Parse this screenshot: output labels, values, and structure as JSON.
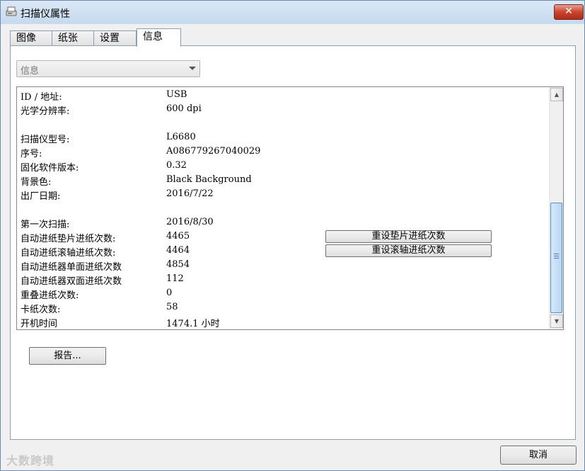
{
  "window": {
    "title": "扫描仪属性",
    "close_glyph": "✕"
  },
  "tabs": [
    {
      "label": "图像",
      "active": false
    },
    {
      "label": "纸张",
      "active": false
    },
    {
      "label": "设置",
      "active": false
    },
    {
      "label": "信息",
      "active": true
    }
  ],
  "info_select": {
    "value": "信息"
  },
  "info_rows": [
    {
      "label": "ID / 地址:",
      "value": "USB"
    },
    {
      "label": "光学分辨率:",
      "value": "600 dpi"
    },
    {
      "label": "扫描仪型号:",
      "value": "L6680"
    },
    {
      "label": "序号:",
      "value": "A086779267040029"
    },
    {
      "label": "固化软件版本:",
      "value": "0.32"
    },
    {
      "label": "背景色:",
      "value": "Black Background"
    },
    {
      "label": "出厂日期:",
      "value": "2016/7/22"
    },
    {
      "label": "第一次扫描:",
      "value": "2016/8/30"
    },
    {
      "label": "自动进纸垫片进纸次数:",
      "value": "4465"
    },
    {
      "label": "自动进纸滚轴进纸次数:",
      "value": "4464"
    },
    {
      "label": "自动进纸器单面进纸次数",
      "value": "4854"
    },
    {
      "label": "自动进纸器双面进纸次数",
      "value": "112"
    },
    {
      "label": "重叠进纸次数:",
      "value": "0"
    },
    {
      "label": "卡纸次数:",
      "value": "58"
    },
    {
      "label": "开机时间",
      "value": "1474.1 小时"
    }
  ],
  "buttons": {
    "reset_pad": "重设垫片进纸次数",
    "reset_roller": "重设滚轴进纸次数",
    "report": "报告...",
    "cancel": "取消"
  },
  "scrollbar": {
    "up_glyph": "▲",
    "down_glyph": "▼"
  },
  "watermark": "大数跨境"
}
